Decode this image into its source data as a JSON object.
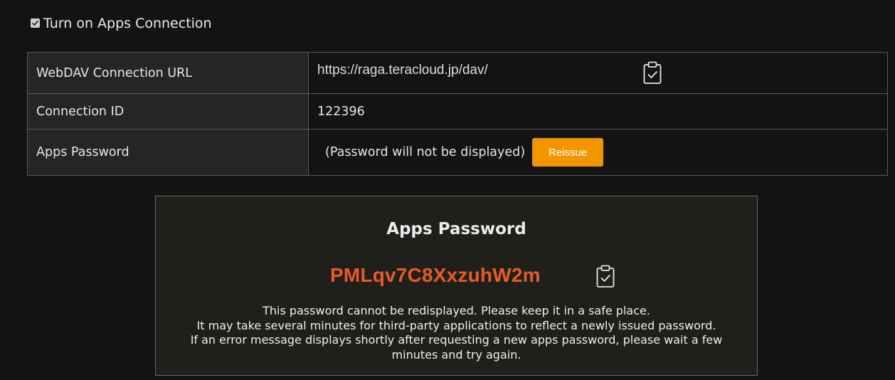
{
  "apps_connection": {
    "checked": true,
    "label": "Turn on Apps Connection"
  },
  "info_table": {
    "webdav_label": "WebDAV Connection URL",
    "webdav_url": "https://raga.teracloud.jp/dav/",
    "connection_id_label": "Connection ID",
    "connection_id": "122396",
    "apps_password_label": "Apps Password",
    "apps_password_note": "(Password will not be displayed)",
    "reissue_label": "Reissue"
  },
  "password_panel": {
    "title": "Apps Password",
    "password": "PMLqv7C8XxzuhW2m",
    "notes": [
      "This password cannot be redisplayed. Please keep it in a safe place.",
      "It may take several minutes for third-party applications to reflect a newly issued password.",
      "If an error message displays shortly after requesting a new apps password, please wait a few minutes and try again."
    ]
  },
  "icons": {
    "copy": "clipboard-check-icon",
    "checkbox": "checkbox-checked-icon"
  },
  "colors": {
    "background": "#131313",
    "label_cell": "#252525",
    "accent_button": "#f29600",
    "password_text": "#e85a25",
    "panel_background": "#1f1f1b"
  }
}
